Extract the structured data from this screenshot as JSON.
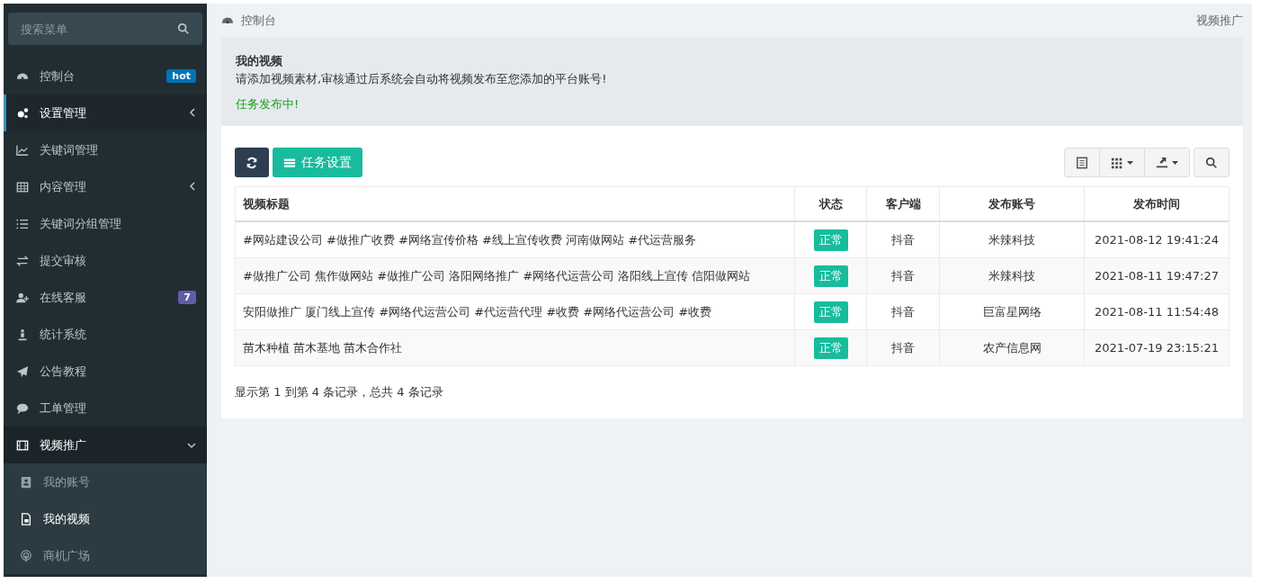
{
  "sidebar": {
    "search": {
      "placeholder": "搜索菜单"
    },
    "items": [
      {
        "label": "控制台",
        "selected": false,
        "badge": {
          "text": "hot",
          "color": "#0073b7"
        }
      },
      {
        "label": "设置管理",
        "selected": true,
        "expanded": false
      },
      {
        "label": "关键词管理",
        "selected": false
      },
      {
        "label": "内容管理",
        "selected": false,
        "expanded": false
      },
      {
        "label": "关键词分组管理",
        "selected": false
      },
      {
        "label": "提交审核",
        "selected": false
      },
      {
        "label": "在线客服",
        "selected": false,
        "badge": {
          "text": "7",
          "color": "#605ca8"
        }
      },
      {
        "label": "统计系统",
        "selected": false
      },
      {
        "label": "公告教程",
        "selected": false
      },
      {
        "label": "工单管理",
        "selected": false
      },
      {
        "label": "视频推广",
        "selected": false,
        "expanded": true,
        "children": [
          {
            "label": "我的账号",
            "selected": false
          },
          {
            "label": "我的视频",
            "selected": true
          },
          {
            "label": "商机广场",
            "selected": false
          }
        ]
      }
    ]
  },
  "breadcrumb": {
    "home": "控制台",
    "current": "视频推广"
  },
  "callout": {
    "title": "我的视频",
    "text": "请添加视频素材,审核通过后系统会自动将视频发布至您添加的平台账号!",
    "status": "任务发布中!"
  },
  "toolbar": {
    "task_button": "任务设置"
  },
  "table": {
    "columns": [
      "视频标题",
      "状态",
      "客户端",
      "发布账号",
      "发布时间"
    ],
    "rows": [
      {
        "title": "#网站建设公司 #做推广收费 #网络宣传价格 #线上宣传收费 河南做网站 #代运营服务",
        "status": "正常",
        "client": "抖音",
        "account": "米辣科技",
        "time": "2021-08-12 19:41:24"
      },
      {
        "title": "#做推广公司 焦作做网站 #做推广公司 洛阳网络推广 #网络代运营公司 洛阳线上宣传 信阳做网站",
        "status": "正常",
        "client": "抖音",
        "account": "米辣科技",
        "time": "2021-08-11 19:47:27"
      },
      {
        "title": "安阳做推广 厦门线上宣传 #网络代运营公司 #代运营代理 #收费 #网络代运营公司 #收费",
        "status": "正常",
        "client": "抖音",
        "account": "巨富星网络",
        "time": "2021-08-11 11:54:48"
      },
      {
        "title": "苗木种植 苗木基地 苗木合作社",
        "status": "正常",
        "client": "抖音",
        "account": "农产信息网",
        "time": "2021-07-19 23:15:21"
      }
    ]
  },
  "pagination": "显示第 1 到第 4 条记录，总共 4 条记录"
}
